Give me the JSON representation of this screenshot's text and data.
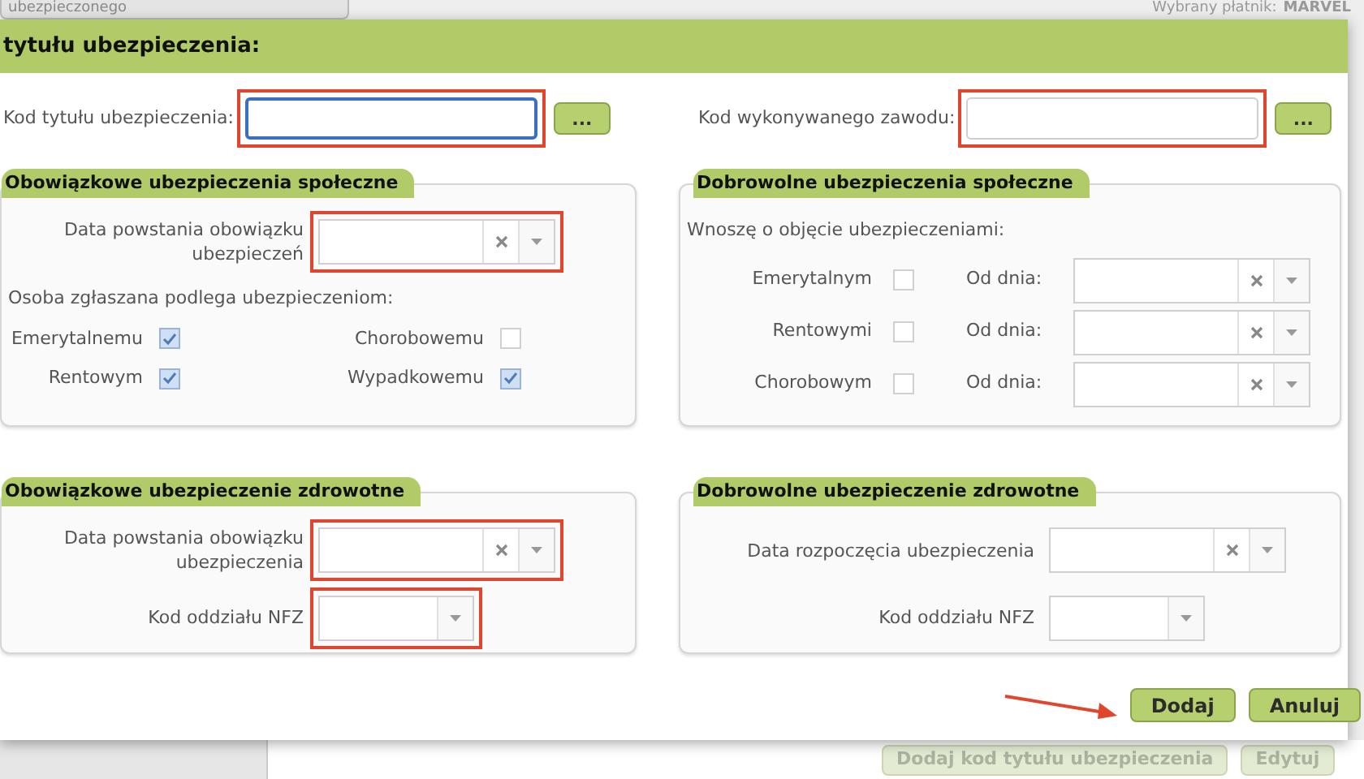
{
  "background": {
    "tab": "ubezpieczonego",
    "payer_label": "Wybrany płatnik:",
    "payer_name": "MARVEL",
    "buttons": [
      {
        "label": "Dodaj kod tytułu ubezpieczenia",
        "disabled": true
      },
      {
        "label": "Edytuj",
        "disabled": true
      }
    ]
  },
  "dialog": {
    "title": "tytułu ubezpieczenia:",
    "code_fields": [
      {
        "label": "Kod tytułu ubezpieczenia:",
        "focused": true,
        "highlighted": true,
        "button": "..."
      },
      {
        "label": "Kod wykonywanego zawodu:",
        "focused": false,
        "highlighted": true,
        "button": "..."
      }
    ],
    "panels": [
      {
        "title": "Obowiązkowe ubezpieczenia społeczne",
        "rows": [
          {
            "kind": "date",
            "label": "Data powstania obowiązku ubezpieczeń",
            "highlighted": true
          },
          {
            "kind": "note",
            "text": "Osoba zgłaszana podlega ubezpieczeniom:"
          },
          {
            "kind": "checks",
            "items": [
              {
                "label": "Emerytalnemu",
                "checked": true
              },
              {
                "label": "Chorobowemu",
                "checked": false
              },
              {
                "label": "Rentowym",
                "checked": true
              },
              {
                "label": "Wypadkowemu",
                "checked": true
              }
            ]
          }
        ]
      },
      {
        "title": "Dobrowolne ubezpieczenia społeczne",
        "rows": [
          {
            "kind": "note",
            "text": "Wnoszę o objęcie ubezpieczeniami:"
          },
          {
            "kind": "check_date",
            "label": "Emerytalnym",
            "checked": false,
            "date_label": "Od dnia:"
          },
          {
            "kind": "check_date",
            "label": "Rentowymi",
            "checked": false,
            "date_label": "Od dnia:"
          },
          {
            "kind": "check_date",
            "label": "Chorobowym",
            "checked": false,
            "date_label": "Od dnia:"
          }
        ]
      },
      {
        "title": "Obowiązkowe ubezpieczenie zdrowotne",
        "rows": [
          {
            "kind": "date",
            "label": "Data powstania obowiązku ubezpieczenia",
            "highlighted": true
          },
          {
            "kind": "select",
            "label": "Kod oddziału NFZ",
            "highlighted": true
          }
        ]
      },
      {
        "title": "Dobrowolne ubezpieczenie zdrowotne",
        "rows": [
          {
            "kind": "date",
            "label": "Data rozpoczęcia ubezpieczenia",
            "highlighted": false
          },
          {
            "kind": "select",
            "label": "Kod oddziału NFZ",
            "highlighted": false
          }
        ]
      }
    ],
    "actions": [
      {
        "label": "Dodaj",
        "pointed": true
      },
      {
        "label": "Anuluj",
        "pointed": false
      }
    ]
  }
}
